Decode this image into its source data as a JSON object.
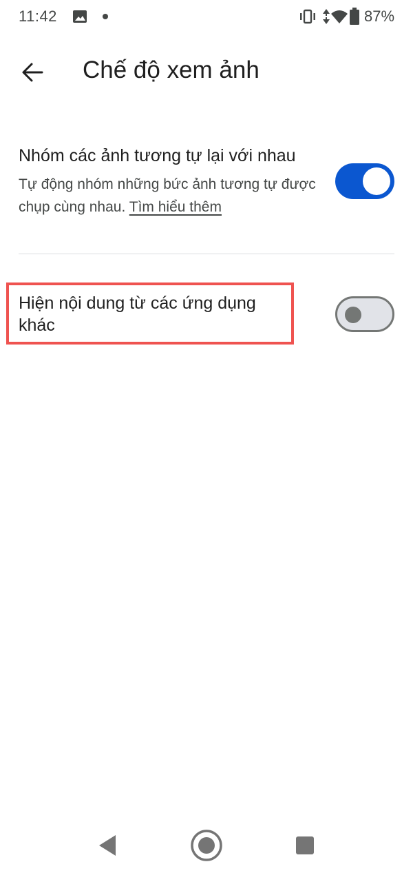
{
  "status_bar": {
    "time": "11:42",
    "battery": "87%",
    "icons": [
      "image-icon",
      "notification-dot",
      "vibrate-icon",
      "data-arrows-icon",
      "wifi-icon",
      "battery-icon"
    ]
  },
  "app_bar": {
    "title": "Chế độ xem ảnh",
    "back_icon": "arrow-back-icon"
  },
  "settings": [
    {
      "title": "Nhóm các ảnh tương tự lại với nhau",
      "description": "Tự động nhóm những bức ảnh tương tự được chụp cùng nhau.",
      "link": "Tìm hiểu thêm",
      "enabled": true
    },
    {
      "title": "Hiện nội dung từ các ứng dụng khác",
      "enabled": false
    }
  ],
  "colors": {
    "switch_on": "#0b57d0",
    "switch_off_track": "#e1e3e8",
    "highlight": "#ef5350"
  },
  "nav_bar": {
    "icons": [
      "nav-back-icon",
      "nav-home-icon",
      "nav-recents-icon"
    ]
  }
}
